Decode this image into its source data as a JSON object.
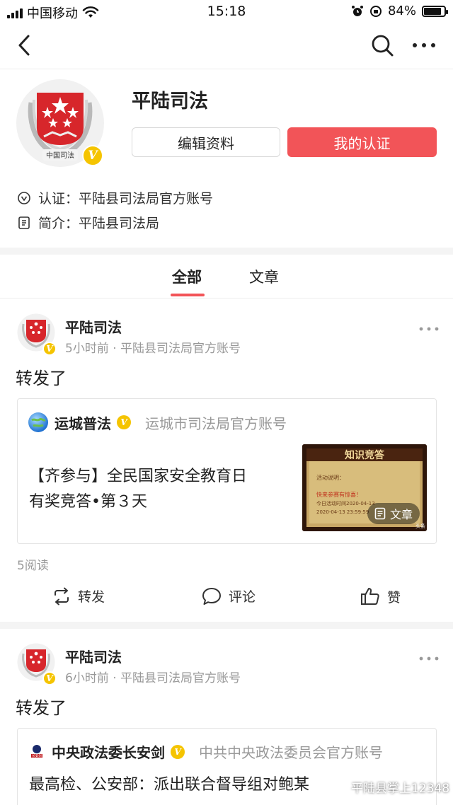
{
  "status_bar": {
    "carrier": "中国移动",
    "time": "15:18",
    "battery_text": "84%",
    "battery_level": 0.84
  },
  "nav": {
    "icons": [
      "back-arrow-icon",
      "search-icon",
      "more-icon"
    ]
  },
  "profile": {
    "name": "平陆司法",
    "avatar_caption": "中国司法",
    "edit_button": "编辑资料",
    "cert_button": "我的认证",
    "certification_label": "认证：",
    "certification_value": "平陆县司法局官方账号",
    "intro_label": "简介：",
    "intro_value": "平陆县司法局"
  },
  "tabs": [
    {
      "label": "全部",
      "active": true
    },
    {
      "label": "文章",
      "active": false
    }
  ],
  "posts": [
    {
      "author": "平陆司法",
      "meta": "5小时前 · 平陆县司法局官方账号",
      "text": "转发了",
      "card": {
        "source_name": "运城普法",
        "source_desc": "运城市司法局官方账号",
        "title_line1": "【齐参与】全民国家安全教育日",
        "title_line2": "有奖竞答•第３天",
        "thumb": {
          "title": "知识竞答",
          "line1": "活动说明：",
          "line2": "快来参赛有惊喜！",
          "line3": "今日活动时间2020-04-13",
          "line4": "2020-04-13 23:59:59",
          "corner": "头条",
          "badge": "文章"
        }
      },
      "read_count": "5阅读",
      "actions": {
        "repost": "转发",
        "comment": "评论",
        "like": "赞"
      }
    },
    {
      "author": "平陆司法",
      "meta": "6小时前 · 平陆县司法局官方账号",
      "text": "转发了",
      "card": {
        "source_name": "中央政法委长安剑",
        "source_desc": "中共中央政法委员会官方账号",
        "logo_text": "长安剑",
        "title_line1": "最高检、公安部：派出联合督导组对鲍某"
      }
    }
  ],
  "watermark": "平陆县掌上12348",
  "colors": {
    "accent_red": "#f25458",
    "verified_gold": "#f5c400",
    "meta_gray": "#999999"
  }
}
